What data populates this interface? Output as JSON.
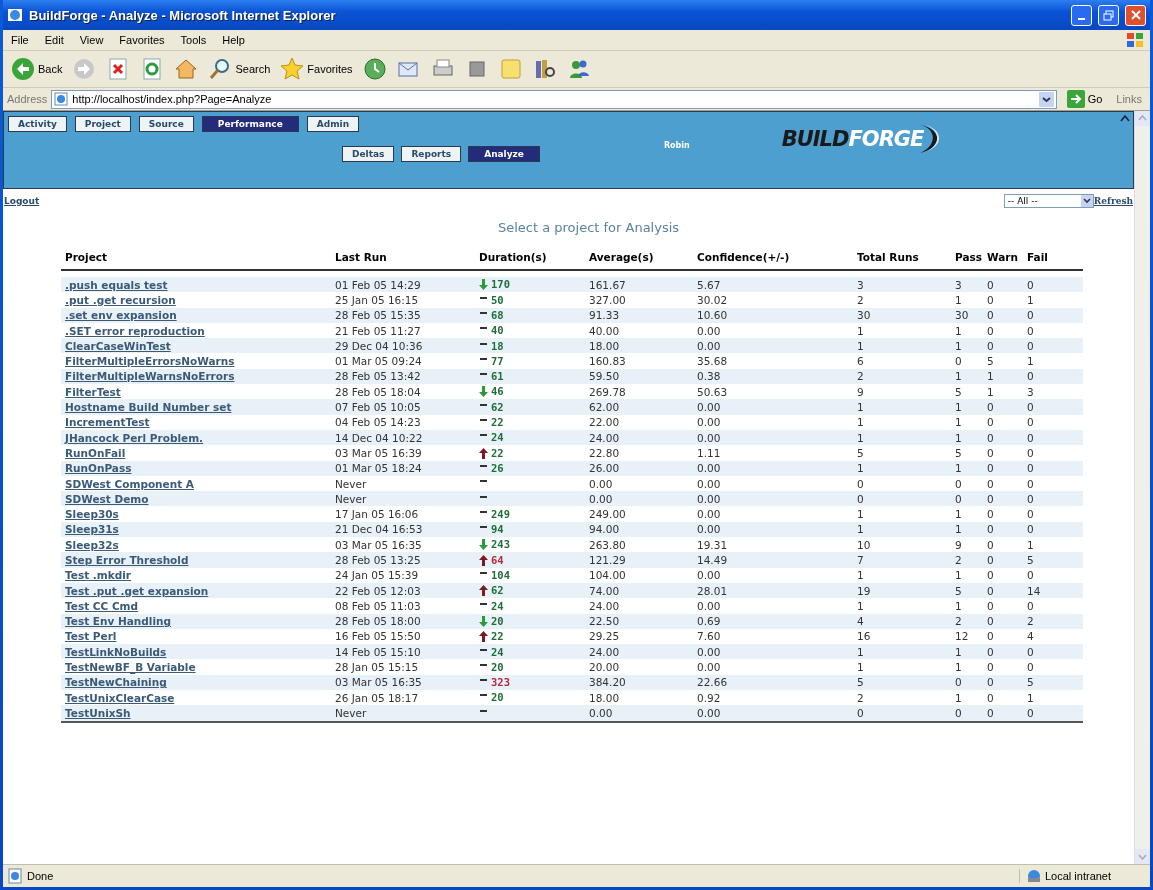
{
  "window": {
    "title": "BuildForge - Analyze - Microsoft Internet Explorer"
  },
  "menu": [
    "File",
    "Edit",
    "View",
    "Favorites",
    "Tools",
    "Help"
  ],
  "toolbar": [
    {
      "kind": "back",
      "label": "Back"
    },
    {
      "kind": "forward"
    },
    {
      "kind": "stop"
    },
    {
      "kind": "refresh"
    },
    {
      "kind": "home"
    },
    {
      "kind": "search",
      "label": "Search"
    },
    {
      "kind": "favorites",
      "label": "Favorites"
    },
    {
      "kind": "history"
    },
    {
      "kind": "mail"
    },
    {
      "kind": "print"
    },
    {
      "kind": "edit"
    },
    {
      "kind": "folder"
    },
    {
      "kind": "research"
    },
    {
      "kind": "messenger"
    }
  ],
  "address": {
    "label": "Address",
    "value": "http://localhost/index.php?Page=Analyze",
    "go": "Go",
    "links": "Links"
  },
  "header": {
    "tabs": [
      {
        "label": "Activity",
        "selected": false
      },
      {
        "label": "Project",
        "selected": false
      },
      {
        "label": "Source",
        "selected": false
      },
      {
        "label": "Performance",
        "selected": true
      },
      {
        "label": "Admin",
        "selected": false
      }
    ],
    "subtabs": [
      {
        "label": "Deltas",
        "selected": false
      },
      {
        "label": "Reports",
        "selected": false
      },
      {
        "label": "Analyze",
        "selected": true
      }
    ],
    "user": "Robin",
    "logo": [
      "BUILD",
      "FORGE"
    ]
  },
  "logout": "Logout",
  "filter": {
    "value": "-- All --"
  },
  "refresh": "Refresh",
  "page_title": "Select a project for Analysis",
  "table": {
    "columns": [
      "Project",
      "Last Run",
      "Duration(s)",
      "Average(s)",
      "Confidence(+/-)",
      "Total Runs",
      "Pass",
      "Warn",
      "Fail"
    ],
    "rows": [
      {
        "project": ".push equals test",
        "last_run": "01 Feb 05 14:29",
        "duration": {
          "kind": "down",
          "value": "170",
          "color": "#1f6e3a"
        },
        "average": "161.67",
        "confidence": "5.67",
        "total_runs": "3",
        "pass": "3",
        "warn": "0",
        "fail": "0"
      },
      {
        "project": ".put .get recursion",
        "last_run": "25 Jan 05 16:15",
        "duration": {
          "kind": "flat",
          "value": "50",
          "color": "#1f6e3a"
        },
        "average": "327.00",
        "confidence": "30.02",
        "total_runs": "2",
        "pass": "1",
        "warn": "0",
        "fail": "1"
      },
      {
        "project": ".set env expansion",
        "last_run": "28 Feb 05 15:35",
        "duration": {
          "kind": "flat",
          "value": "68",
          "color": "#1f6e3a"
        },
        "average": "91.33",
        "confidence": "10.60",
        "total_runs": "30",
        "pass": "30",
        "warn": "0",
        "fail": "0"
      },
      {
        "project": ".SET error reproduction",
        "last_run": "21 Feb 05 11:27",
        "duration": {
          "kind": "flat",
          "value": "40",
          "color": "#1f6e3a"
        },
        "average": "40.00",
        "confidence": "0.00",
        "total_runs": "1",
        "pass": "1",
        "warn": "0",
        "fail": "0"
      },
      {
        "project": "ClearCaseWinTest",
        "last_run": "29 Dec 04 10:36",
        "duration": {
          "kind": "flat",
          "value": "18",
          "color": "#1f6e3a"
        },
        "average": "18.00",
        "confidence": "0.00",
        "total_runs": "1",
        "pass": "1",
        "warn": "0",
        "fail": "0"
      },
      {
        "project": "FilterMultipleErrorsNoWarns",
        "last_run": "01 Mar 05 09:24",
        "duration": {
          "kind": "flat",
          "value": "77",
          "color": "#1f6e3a"
        },
        "average": "160.83",
        "confidence": "35.68",
        "total_runs": "6",
        "pass": "0",
        "warn": "5",
        "fail": "1"
      },
      {
        "project": "FilterMultipleWarnsNoErrors",
        "last_run": "28 Feb 05 13:42",
        "duration": {
          "kind": "flat",
          "value": "61",
          "color": "#1f6e3a"
        },
        "average": "59.50",
        "confidence": "0.38",
        "total_runs": "2",
        "pass": "1",
        "warn": "1",
        "fail": "0"
      },
      {
        "project": "FilterTest",
        "last_run": "28 Feb 05 18:04",
        "duration": {
          "kind": "down",
          "value": "46",
          "color": "#1f6e3a"
        },
        "average": "269.78",
        "confidence": "50.63",
        "total_runs": "9",
        "pass": "5",
        "warn": "1",
        "fail": "3"
      },
      {
        "project": "Hostname Build Number set",
        "last_run": "07 Feb 05 10:05",
        "duration": {
          "kind": "flat",
          "value": "62",
          "color": "#1f6e3a"
        },
        "average": "62.00",
        "confidence": "0.00",
        "total_runs": "1",
        "pass": "1",
        "warn": "0",
        "fail": "0"
      },
      {
        "project": "IncrementTest",
        "last_run": "04 Feb 05 14:23",
        "duration": {
          "kind": "flat",
          "value": "22",
          "color": "#1f6e3a"
        },
        "average": "22.00",
        "confidence": "0.00",
        "total_runs": "1",
        "pass": "1",
        "warn": "0",
        "fail": "0"
      },
      {
        "project": "JHancock Perl Problem.",
        "last_run": "14 Dec 04 10:22",
        "duration": {
          "kind": "flat",
          "value": "24",
          "color": "#1f6e3a"
        },
        "average": "24.00",
        "confidence": "0.00",
        "total_runs": "1",
        "pass": "1",
        "warn": "0",
        "fail": "0"
      },
      {
        "project": "RunOnFail",
        "last_run": "03 Mar 05 16:39",
        "duration": {
          "kind": "up",
          "value": "22",
          "color": "#1f6e3a"
        },
        "average": "22.80",
        "confidence": "1.11",
        "total_runs": "5",
        "pass": "5",
        "warn": "0",
        "fail": "0"
      },
      {
        "project": "RunOnPass",
        "last_run": "01 Mar 05 18:24",
        "duration": {
          "kind": "flat",
          "value": "26",
          "color": "#1f6e3a"
        },
        "average": "26.00",
        "confidence": "0.00",
        "total_runs": "1",
        "pass": "1",
        "warn": "0",
        "fail": "0"
      },
      {
        "project": "SDWest Component A",
        "last_run": "Never",
        "duration": {
          "kind": "flat"
        },
        "average": "0.00",
        "confidence": "0.00",
        "total_runs": "0",
        "pass": "0",
        "warn": "0",
        "fail": "0"
      },
      {
        "project": "SDWest Demo",
        "last_run": "Never",
        "duration": {
          "kind": "flat"
        },
        "average": "0.00",
        "confidence": "0.00",
        "total_runs": "0",
        "pass": "0",
        "warn": "0",
        "fail": "0"
      },
      {
        "project": "Sleep30s",
        "last_run": "17 Jan 05 16:06",
        "duration": {
          "kind": "flat",
          "value": "249",
          "color": "#1f6e3a"
        },
        "average": "249.00",
        "confidence": "0.00",
        "total_runs": "1",
        "pass": "1",
        "warn": "0",
        "fail": "0"
      },
      {
        "project": "Sleep31s",
        "last_run": "21 Dec 04 16:53",
        "duration": {
          "kind": "flat",
          "value": "94",
          "color": "#1f6e3a"
        },
        "average": "94.00",
        "confidence": "0.00",
        "total_runs": "1",
        "pass": "1",
        "warn": "0",
        "fail": "0"
      },
      {
        "project": "Sleep32s",
        "last_run": "03 Mar 05 16:35",
        "duration": {
          "kind": "down",
          "value": "243",
          "color": "#1f6e3a"
        },
        "average": "263.80",
        "confidence": "19.31",
        "total_runs": "10",
        "pass": "9",
        "warn": "0",
        "fail": "1"
      },
      {
        "project": "Step Error Threshold",
        "last_run": "28 Feb 05 13:25",
        "duration": {
          "kind": "up",
          "value": "64",
          "color": "#b02a3a"
        },
        "average": "121.29",
        "confidence": "14.49",
        "total_runs": "7",
        "pass": "2",
        "warn": "0",
        "fail": "5"
      },
      {
        "project": "Test .mkdir",
        "last_run": "24 Jan 05 15:39",
        "duration": {
          "kind": "flat",
          "value": "104",
          "color": "#1f6e3a"
        },
        "average": "104.00",
        "confidence": "0.00",
        "total_runs": "1",
        "pass": "1",
        "warn": "0",
        "fail": "0"
      },
      {
        "project": "Test .put .get expansion",
        "last_run": "22 Feb 05 12:03",
        "duration": {
          "kind": "up",
          "value": "62",
          "color": "#1f6e3a"
        },
        "average": "74.00",
        "confidence": "28.01",
        "total_runs": "19",
        "pass": "5",
        "warn": "0",
        "fail": "14"
      },
      {
        "project": "Test CC Cmd",
        "last_run": "08 Feb 05 11:03",
        "duration": {
          "kind": "flat",
          "value": "24",
          "color": "#1f6e3a"
        },
        "average": "24.00",
        "confidence": "0.00",
        "total_runs": "1",
        "pass": "1",
        "warn": "0",
        "fail": "0"
      },
      {
        "project": "Test Env Handling",
        "last_run": "28 Feb 05 18:00",
        "duration": {
          "kind": "down",
          "value": "20",
          "color": "#1f6e3a"
        },
        "average": "22.50",
        "confidence": "0.69",
        "total_runs": "4",
        "pass": "2",
        "warn": "0",
        "fail": "2"
      },
      {
        "project": "Test Perl",
        "last_run": "16 Feb 05 15:50",
        "duration": {
          "kind": "up",
          "value": "22",
          "color": "#1f6e3a"
        },
        "average": "29.25",
        "confidence": "7.60",
        "total_runs": "16",
        "pass": "12",
        "warn": "0",
        "fail": "4"
      },
      {
        "project": "TestLinkNoBuilds",
        "last_run": "14 Feb 05 15:10",
        "duration": {
          "kind": "flat",
          "value": "24",
          "color": "#1f6e3a"
        },
        "average": "24.00",
        "confidence": "0.00",
        "total_runs": "1",
        "pass": "1",
        "warn": "0",
        "fail": "0"
      },
      {
        "project": "TestNewBF_B Variable",
        "last_run": "28 Jan 05 15:15",
        "duration": {
          "kind": "flat",
          "value": "20",
          "color": "#1f6e3a"
        },
        "average": "20.00",
        "confidence": "0.00",
        "total_runs": "1",
        "pass": "1",
        "warn": "0",
        "fail": "0"
      },
      {
        "project": "TestNewChaining",
        "last_run": "03 Mar 05 16:35",
        "duration": {
          "kind": "flat",
          "value": "323",
          "color": "#b02a3a"
        },
        "average": "384.20",
        "confidence": "22.66",
        "total_runs": "5",
        "pass": "0",
        "warn": "0",
        "fail": "5"
      },
      {
        "project": "TestUnixClearCase",
        "last_run": "26 Jan 05 18:17",
        "duration": {
          "kind": "flat",
          "value": "20",
          "color": "#1f6e3a"
        },
        "average": "18.00",
        "confidence": "0.92",
        "total_runs": "2",
        "pass": "1",
        "warn": "0",
        "fail": "1"
      },
      {
        "project": "TestUnixSh",
        "last_run": "Never",
        "duration": {
          "kind": "flat"
        },
        "average": "0.00",
        "confidence": "0.00",
        "total_runs": "0",
        "pass": "0",
        "warn": "0",
        "fail": "0"
      }
    ]
  },
  "status_bar": {
    "text": "Done",
    "zone": "Local intranet"
  }
}
